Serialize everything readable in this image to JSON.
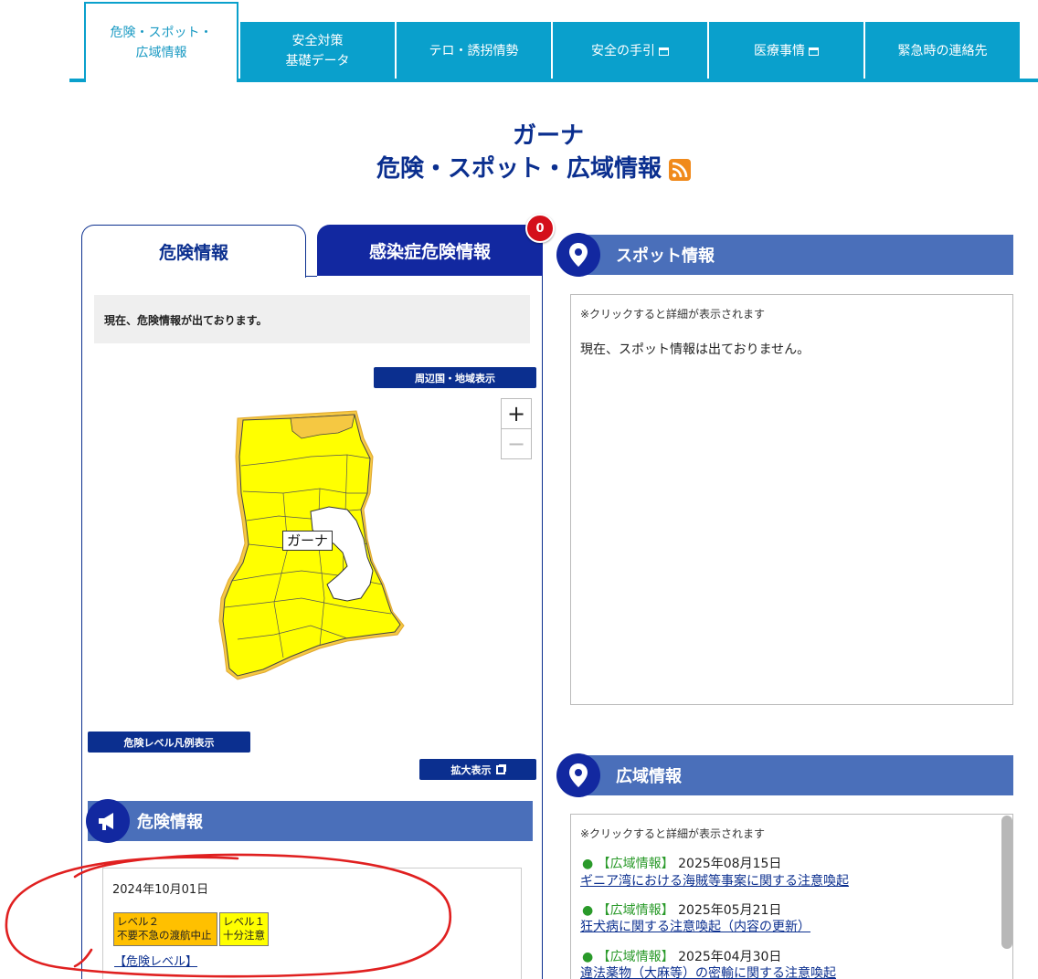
{
  "nav": {
    "tabs": [
      {
        "label": "危険・スポット・\n広域情報",
        "active": true
      },
      {
        "label": "安全対策\n基礎データ"
      },
      {
        "label": "テロ・誘拐情勢"
      },
      {
        "label": "安全の手引"
      },
      {
        "label": "医療事情"
      },
      {
        "label": "緊急時の連絡先"
      }
    ]
  },
  "page": {
    "country": "ガーナ",
    "subtitle": "危険・スポット・広域情報"
  },
  "left": {
    "tab_danger": "危険情報",
    "tab_infection": "感染症危険情報",
    "infection_badge": "0",
    "notice": "現在、危険情報が出ております。",
    "btn_neighbors": "周辺国・地域表示",
    "zoom_in": "+",
    "zoom_out": "−",
    "map_label": "ガーナ",
    "btn_legend": "危険レベル凡例表示",
    "btn_enlarge": "拡大表示",
    "section_title": "危険情報",
    "risk_date": "2024年10月01日",
    "level2": "レベル２\n不要不急の渡航中止",
    "level1": "レベル１\n十分注意",
    "level2_color": "#ffc000",
    "level1_color": "#ffff00",
    "risk_link": "【危険レベル】"
  },
  "right": {
    "spot_title": "スポット情報",
    "spot_hint": "※クリックすると詳細が表示されます",
    "spot_empty": "現在、スポット情報は出ておりません。",
    "wide_title": "広域情報",
    "wide_hint": "※クリックすると詳細が表示されます",
    "wide_items": [
      {
        "category": "【広域情報】",
        "date": "2025年08月15日",
        "title": "ギニア湾における海賊等事案に関する注意喚起"
      },
      {
        "category": "【広域情報】",
        "date": "2025年05月21日",
        "title": "狂犬病に関する注意喚起（内容の更新）"
      },
      {
        "category": "【広域情報】",
        "date": "2025年04月30日",
        "title": "違法薬物（大麻等）の密輸に関する注意喚起"
      }
    ]
  },
  "colors": {
    "tab_bg": "#0aa0cc",
    "navy": "#0b2f8f",
    "header_blue": "#4a6fba",
    "map_yellow": "#ffff00",
    "map_orange": "#f5c842",
    "badge_red": "#d40f1a",
    "annotation_red": "#e02020"
  }
}
